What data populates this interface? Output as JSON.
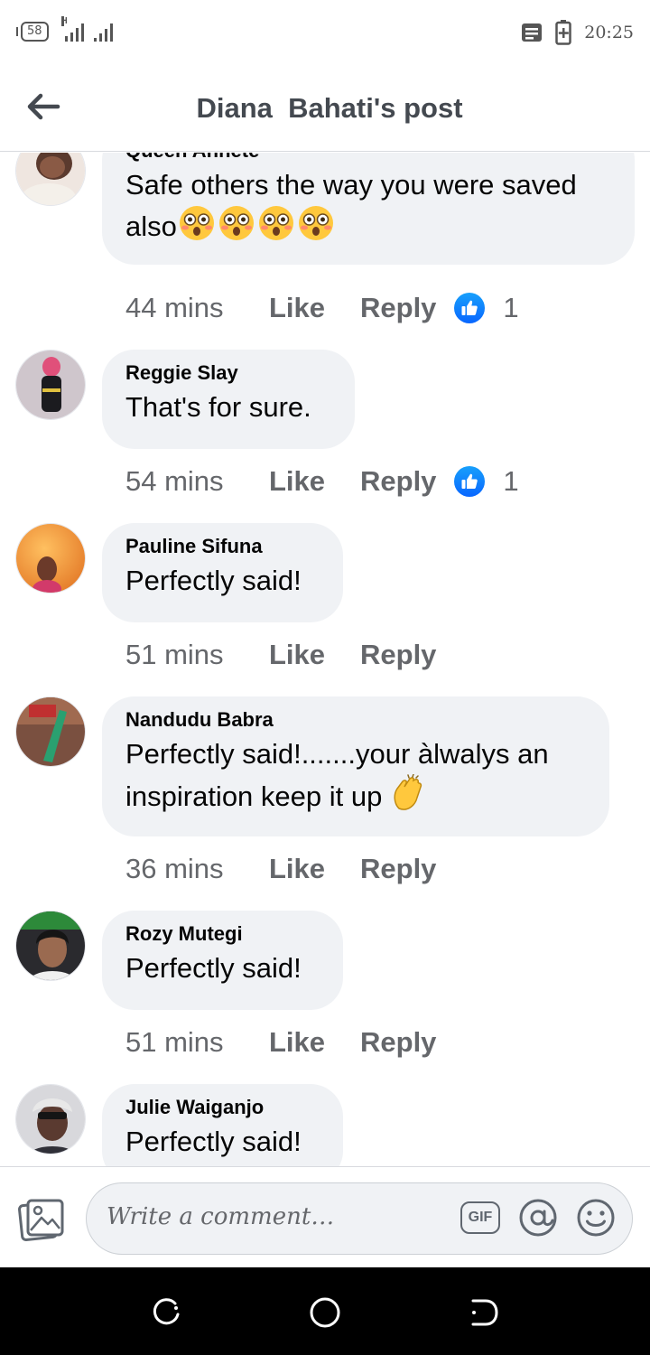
{
  "status_bar": {
    "network_badge": "58",
    "signal_type": "H",
    "time": "20:25",
    "icons": [
      "notification-icon",
      "battery-charging-icon"
    ]
  },
  "header": {
    "back_icon": "arrow-left-icon",
    "title": "Diana  Bahati's post"
  },
  "comments": [
    {
      "author": "Queen Annete",
      "text": "Safe others the way you were saved also",
      "emoji": [
        "flushed-face",
        "flushed-face",
        "flushed-face",
        "flushed-face"
      ],
      "time": "44 mins",
      "like_label": "Like",
      "reply_label": "Reply",
      "reaction_count": "1",
      "avatar_color": "#c9a99a"
    },
    {
      "author": "Reggie Slay",
      "text": "That's for sure.",
      "time": "54 mins",
      "like_label": "Like",
      "reply_label": "Reply",
      "reaction_count": "1",
      "avatar_color": "#b8a0a8"
    },
    {
      "author": "Pauline Sifuna",
      "text": "Perfectly said!",
      "time": "51 mins",
      "like_label": "Like",
      "reply_label": "Reply",
      "avatar_color": "#f2a030"
    },
    {
      "author": "Nandudu Babra",
      "text": "Perfectly said!.......your àlwalys an inspiration keep it up",
      "emoji": [
        "clapping-hands"
      ],
      "time": "36 mins",
      "like_label": "Like",
      "reply_label": "Reply",
      "avatar_color": "#8a5a40"
    },
    {
      "author": "Rozy Mutegi",
      "text": "Perfectly said!",
      "time": "51 mins",
      "like_label": "Like",
      "reply_label": "Reply",
      "avatar_color": "#3a3030"
    },
    {
      "author": "Julie Waiganjo",
      "text": "Perfectly said!",
      "avatar_color": "#6a6a70"
    }
  ],
  "composer": {
    "placeholder": "Write a comment…",
    "gif_label": "GIF",
    "icons": [
      "photo-icon",
      "gif-icon",
      "mention-icon",
      "emoji-icon"
    ]
  },
  "nav_bar": {
    "icons": [
      "recent-apps-icon",
      "home-icon",
      "back-icon"
    ]
  },
  "colors": {
    "bubble": "#f0f2f5",
    "secondary_text": "#65676b",
    "like_blue": "#0866ff"
  }
}
